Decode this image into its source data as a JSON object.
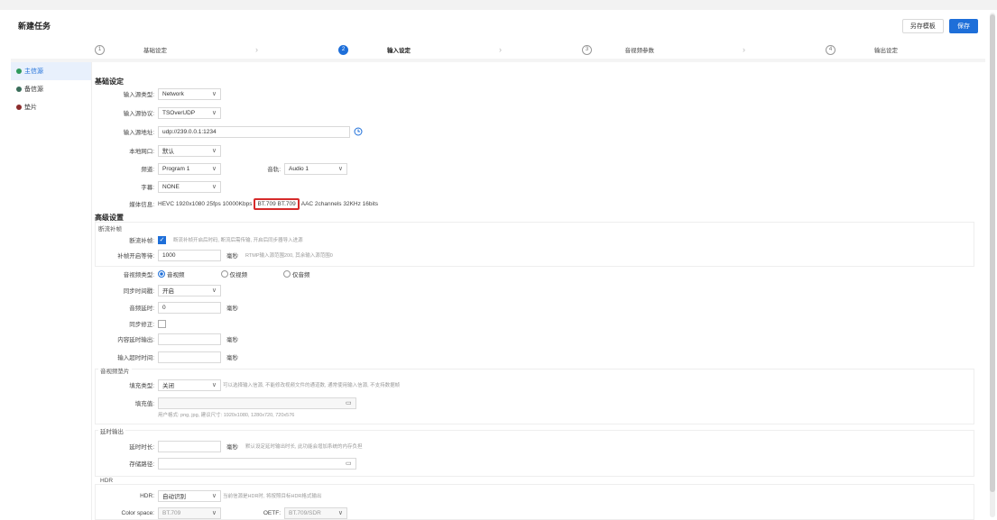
{
  "header": {
    "title": "新建任务",
    "save_as_template": "另存模板",
    "save": "保存"
  },
  "steps": [
    {
      "num": "1",
      "label": "基础设定"
    },
    {
      "num": "2",
      "label": "输入设定"
    },
    {
      "num": "3",
      "label": "音视频参数"
    },
    {
      "num": "4",
      "label": "输出设定"
    }
  ],
  "sidebar": {
    "items": [
      {
        "label": "主信源",
        "color": "#2e9a5c"
      },
      {
        "label": "备信源",
        "color": "#3a6d5a"
      },
      {
        "label": "垫片",
        "color": "#8b2c2c"
      }
    ]
  },
  "basic": {
    "title": "基础设定",
    "input_type_label": "输入源类型:",
    "input_type_value": "Network",
    "protocol_label": "输入源协议:",
    "protocol_value": "TSOverUDP",
    "address_label": "输入源地址:",
    "address_value": "udp://239.0.0.1:1234",
    "local_port_label": "本地网口:",
    "local_port_value": "默认",
    "program_label": "频道:",
    "program_value": "Program 1",
    "audio_label": "音轨:",
    "audio_value": "Audio 1",
    "subtitle_label": "字幕:",
    "subtitle_value": "NONE",
    "media_info_label": "媒体信息:",
    "media_info_pre": "HEVC 1920x1080 25fps 10000Kbps",
    "media_info_hl": "BT.709 BT.709",
    "media_info_post": "AAC 2channels 32KHz 16bits"
  },
  "advanced": {
    "title": "高级设置",
    "group1_title": "断流补帧",
    "fill_frame_label": "断流补帧:",
    "fill_frame_hint": "断流补帧开启后时码, 断流后需传输, 开启后同步器导入进源",
    "fill_wait_label": "补帧开启等待:",
    "fill_wait_value": "1000",
    "fill_wait_unit": "毫秒",
    "fill_wait_hint": "RTMP输入源范围200, 其余输入源范围0",
    "audio_type_label": "音视频类型:",
    "audio_type_opts": [
      "音视频",
      "仅视频",
      "仅音频"
    ],
    "copy_sync_label": "同步时间戳:",
    "copy_sync_value": "开启",
    "audio_delay_label": "音频延时:",
    "audio_delay_value": "0",
    "audio_delay_unit": "毫秒",
    "sync_cross_label": "同步修正:",
    "max_delay_label": "内容延时输出:",
    "max_delay_unit": "毫秒",
    "input_timeout_label": "输入超时时间:",
    "input_timeout_unit": "毫秒",
    "group2_title": "音视频垫片",
    "fill_type_label": "填充类型:",
    "fill_type_value": "关闭",
    "fill_type_hint": "可以选择输入信源, 不能修改视频文件的通道数, 通常使用输入信源, 不支持数据帧",
    "fill_content_label": "填充值:",
    "fill_content_hint": "用户格式: png, jpg, 建议尺寸: 1920x1080, 1280x720, 720x576",
    "group3_title": "延时输出",
    "delay_time_label": "延时时长:",
    "delay_time_unit": "毫秒",
    "delay_time_hint": "默认设定延时输出时长, 此功能会增加系统的内存负担",
    "delay_path_label": "存储路径:",
    "group4_title": "HDR",
    "hdr_label": "HDR:",
    "hdr_value": "自动识别",
    "hdr_hint": "当前信源是HDR时, 将按照目标HDR格式输出",
    "color_space_label": "Color space:",
    "color_space_value": "BT.709",
    "oetf_label": "OETF:",
    "oetf_value": "BT.709/SDR"
  }
}
